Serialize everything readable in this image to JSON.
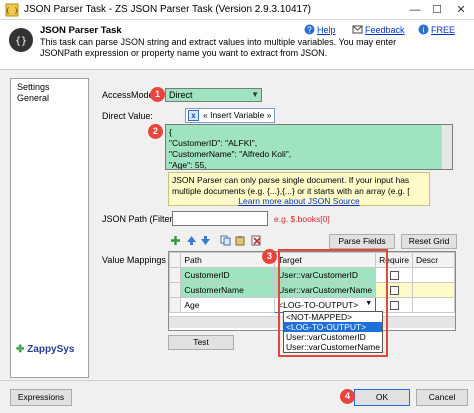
{
  "window": {
    "title": "JSON Parser Task - ZS JSON Parser Task (Version 2.9.3.10417)",
    "minimize_glyph": "—",
    "maximize_glyph": "☐",
    "close_glyph": "✕"
  },
  "header": {
    "title": "JSON Parser Task",
    "description": "This task can parse JSON string and extract values into multiple variables. You may enter JSONPath expression or property name you want to extract from JSON.",
    "help_label": "Help",
    "feedback_label": "Feedback",
    "free_label": "FREE"
  },
  "sidebar": {
    "items": [
      {
        "label": "Settings"
      },
      {
        "label": "General"
      }
    ]
  },
  "form": {
    "access_mode_label": "AccessMode:",
    "access_mode_value": "Direct",
    "direct_value_label": "Direct Value:",
    "insert_variable_label": "« Insert Variable »",
    "editor_lines": [
      "{",
      "\"CustomerID\": \"ALFKI\",",
      "\"CustomerName\": \"Alfredo Koli\",",
      "\"Age\": 55,"
    ],
    "note_text": "JSON Parser can only parse single document. If your input has multiple documents (e.g. {...},{...} or it starts with an array (e.g. [",
    "note_link": "Learn more about JSON Source",
    "json_path_label": "JSON Path (Filter)",
    "json_path_value": "",
    "json_path_hint": "e.g. $.books[0]",
    "parse_fields_label": "Parse Fields",
    "reset_grid_label": "Reset Grid",
    "value_mappings_label": "Value Mappings",
    "test_label": "Test"
  },
  "grid": {
    "columns": [
      "Path",
      "Target",
      "Require",
      "Descr"
    ],
    "rows": [
      {
        "path": "CustomerID",
        "target": "User::varCustomerID"
      },
      {
        "path": "CustomerName",
        "target": "User::varCustomerName"
      },
      {
        "path": "Age",
        "target": "<LOG-TO-OUTPUT>"
      }
    ],
    "dropdown_options": [
      "<NOT-MAPPED>",
      "<LOG-TO-OUTPUT>",
      "User::varCustomerID",
      "User::varCustomerName"
    ],
    "dropdown_selected_index": 1
  },
  "badges": {
    "b1": "1",
    "b2": "2",
    "b3": "3",
    "b4": "4"
  },
  "footer": {
    "logo_text": "ZappySys",
    "expressions_label": "Expressions",
    "ok_label": "OK",
    "cancel_label": "Cancel"
  },
  "colors": {
    "accent_red": "#e8453c",
    "field_green": "#9fe3c0",
    "note_yellow": "#fffbc8",
    "link_blue": "#0033cc"
  },
  "icons": [
    "app-icon",
    "help-icon",
    "feedback-icon",
    "free-icon",
    "add-icon",
    "up-icon",
    "down-icon",
    "copy-icon",
    "paste-icon",
    "delete-icon"
  ]
}
